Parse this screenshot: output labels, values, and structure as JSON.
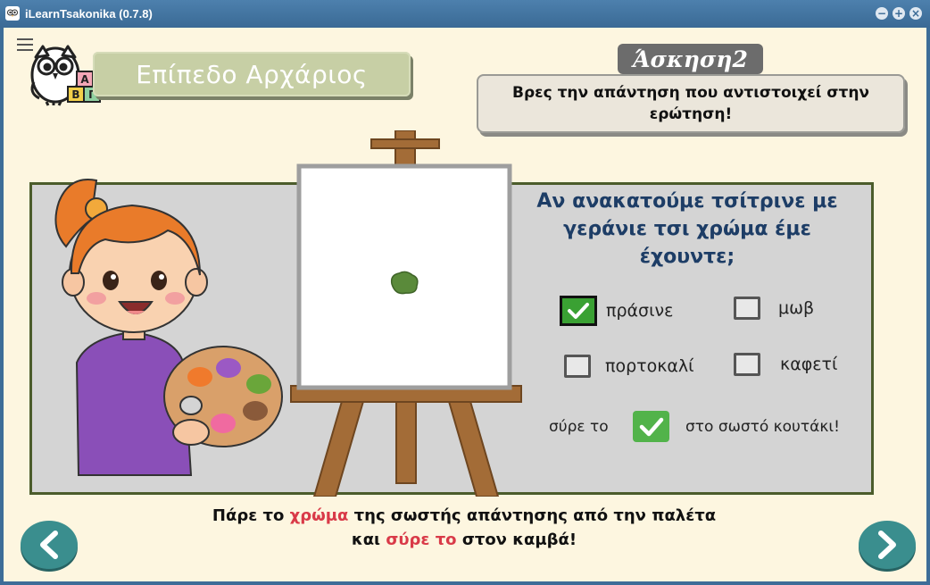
{
  "window": {
    "title": "iLearnTsakonika (0.7.8)",
    "buttons": {
      "minimize": "−",
      "maximize": "+",
      "close": "×"
    }
  },
  "header": {
    "menu_icon": "hamburger-menu-icon",
    "mascot_blocks": [
      "Α",
      "Β",
      "Γ"
    ],
    "level_label": "Επίπεδο Αρχάριος",
    "exercise_label": "Άσκηση2",
    "instruction": "Βρες την απάντηση που αντιστοιχεί στην ερώτηση!"
  },
  "question": {
    "text": "Αν ανακατούμε τσίτρινε με γεράνιε τσι χρώμα έμε έχουντε;"
  },
  "options": [
    {
      "label": "πράσινε",
      "checked": true
    },
    {
      "label": "μωβ",
      "checked": false
    },
    {
      "label": "πορτοκαλί",
      "checked": false
    },
    {
      "label": "καφετί",
      "checked": false
    }
  ],
  "drag_hint": {
    "before": "σύρε το",
    "after": "στο σωστό κουτάκι!"
  },
  "bottom": {
    "line1_a": "Πάρε το ",
    "line1_hl": "χρώμα",
    "line1_b": " της σωστής απάντησης από την παλέτα",
    "line2_a": "και ",
    "line2_hl": "σύρε το",
    "line2_b": " στον καμβά!"
  },
  "colors": {
    "accent_teal": "#3a8e8e",
    "check_green": "#3aa133",
    "highlight_red": "#d93a48",
    "panel_border": "#4b5c2b",
    "question_blue": "#1d3d66",
    "paint_blob": "#5a8a3a"
  }
}
